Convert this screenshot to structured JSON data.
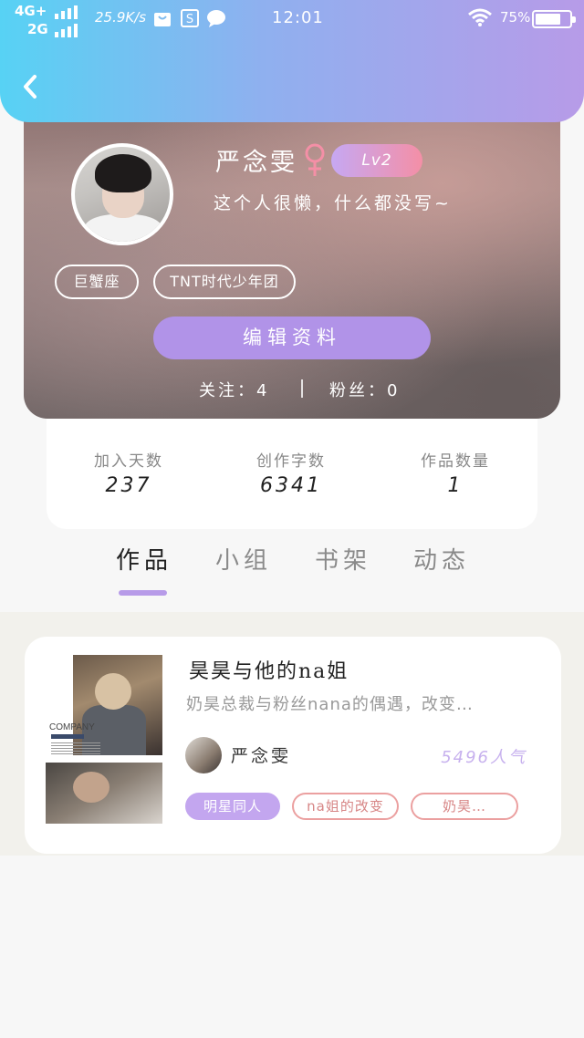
{
  "status_bar": {
    "network_top": "4G+",
    "network_bottom": "2G",
    "speed": "25.9K/s",
    "time": "12:01",
    "battery_percent": "75%",
    "battery_level": 0.75,
    "icons": [
      "bag-icon",
      "s-app-icon",
      "message-bubble-icon",
      "wifi-icon",
      "battery-icon"
    ]
  },
  "header": {
    "back_icon": "chevron-left-icon",
    "gradient_colors": [
      "#57d2f4",
      "#b79be8"
    ]
  },
  "profile": {
    "username": "严念雯",
    "gender_icon": "female-icon",
    "gender_color": "#f48fa6",
    "level": "Lv2",
    "bio": "这个人很懒，什么都没写~",
    "tags": [
      "巨蟹座",
      "TNT时代少年团"
    ],
    "edit_button": "编辑资料",
    "following_label": "关注：",
    "following_count": "4",
    "followers_label": "粉丝：",
    "followers_count": "0"
  },
  "stats": [
    {
      "label": "加入天数",
      "value": "237"
    },
    {
      "label": "创作字数",
      "value": "6341"
    },
    {
      "label": "作品数量",
      "value": "1"
    }
  ],
  "tabs": [
    {
      "label": "作品",
      "active": true
    },
    {
      "label": "小组",
      "active": false
    },
    {
      "label": "书架",
      "active": false
    },
    {
      "label": "动态",
      "active": false
    }
  ],
  "works": [
    {
      "title": "昊昊与他的na姐",
      "description": "奶昊总裁与粉丝nana的偶遇，改变…",
      "cover_text": "COMPANY",
      "author": "严念雯",
      "popularity": "5496人气",
      "tags": [
        "明星同人",
        "na姐的改变",
        "奶昊…"
      ]
    }
  ],
  "colors": {
    "accent_purple": "#b193e8",
    "tab_underline": "#b79be8",
    "tag_red": "#eba0a0"
  }
}
